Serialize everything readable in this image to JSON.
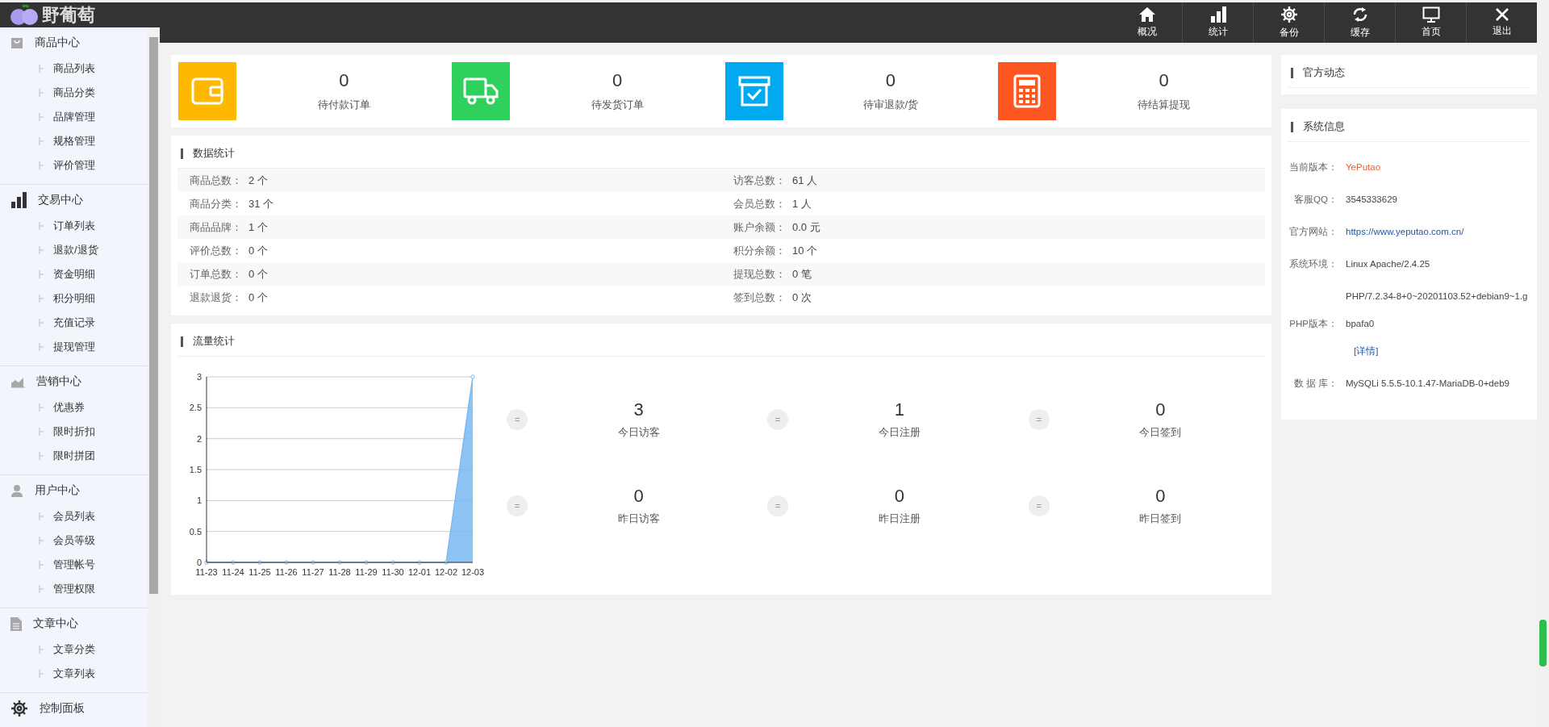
{
  "logo": {
    "text": "野葡萄"
  },
  "top_nav": [
    {
      "label": "概况"
    },
    {
      "label": "统计"
    },
    {
      "label": "备份"
    },
    {
      "label": "缓存"
    },
    {
      "label": "首页"
    },
    {
      "label": "退出"
    }
  ],
  "sidebar": {
    "groups": [
      {
        "title": "商品中心",
        "items": [
          "商品列表",
          "商品分类",
          "品牌管理",
          "规格管理",
          "评价管理"
        ]
      },
      {
        "title": "交易中心",
        "items": [
          "订单列表",
          "退款/退货",
          "资金明细",
          "积分明细",
          "充值记录",
          "提现管理"
        ]
      },
      {
        "title": "营销中心",
        "items": [
          "优惠券",
          "限时折扣",
          "限时拼团"
        ]
      },
      {
        "title": "用户中心",
        "items": [
          "会员列表",
          "会员等级",
          "管理帐号",
          "管理权限"
        ]
      },
      {
        "title": "文章中心",
        "items": [
          "文章分类",
          "文章列表"
        ]
      },
      {
        "title": "控制面板"
      }
    ]
  },
  "summary_cards": [
    {
      "color": "#ffb800",
      "value": "0",
      "label": "待付款订单"
    },
    {
      "color": "#2fd15d",
      "value": "0",
      "label": "待发货订单"
    },
    {
      "color": "#00a9f0",
      "value": "0",
      "label": "待审退款/货"
    },
    {
      "color": "#ff5722",
      "value": "0",
      "label": "待结算提现"
    }
  ],
  "data_stats": {
    "title": "数据统计",
    "rows": [
      [
        {
          "label": "商品总数：",
          "value": "2 个"
        },
        {
          "label": "访客总数：",
          "value": "61 人"
        }
      ],
      [
        {
          "label": "商品分类：",
          "value": "31 个"
        },
        {
          "label": "会员总数：",
          "value": "1 人"
        }
      ],
      [
        {
          "label": "商品品牌：",
          "value": "1 个"
        },
        {
          "label": "账户余额：",
          "value": "0.0 元"
        }
      ],
      [
        {
          "label": "评价总数：",
          "value": "0 个"
        },
        {
          "label": "积分余额：",
          "value": "10 个"
        }
      ],
      [
        {
          "label": "订单总数：",
          "value": "0 个"
        },
        {
          "label": "提现总数：",
          "value": "0 笔"
        }
      ],
      [
        {
          "label": "退款退货：",
          "value": "0 个"
        },
        {
          "label": "签到总数：",
          "value": "0 次"
        }
      ]
    ]
  },
  "traffic": {
    "title": "流量统计",
    "chart_data": {
      "type": "area",
      "categories": [
        "11-23",
        "11-24",
        "11-25",
        "11-26",
        "11-27",
        "11-28",
        "11-29",
        "11-30",
        "12-01",
        "12-02",
        "12-03"
      ],
      "grid": true,
      "series": [
        {
          "color": "#7ab8f5",
          "values": [
            0,
            0,
            0,
            0,
            0,
            0,
            0,
            0,
            0,
            0,
            3
          ]
        }
      ],
      "ylim": [
        0,
        3
      ],
      "yticks": [
        0,
        0.5,
        1,
        1.5,
        2,
        2.5,
        3
      ]
    },
    "counters": [
      {
        "badge": "=",
        "value": "3",
        "label": "今日访客"
      },
      {
        "badge": "=",
        "value": "1",
        "label": "今日注册"
      },
      {
        "badge": "=",
        "value": "0",
        "label": "今日签到"
      },
      {
        "badge": "=",
        "value": "0",
        "label": "昨日访客"
      },
      {
        "badge": "=",
        "value": "0",
        "label": "昨日注册"
      },
      {
        "badge": "=",
        "value": "0",
        "label": "昨日签到"
      }
    ]
  },
  "news": {
    "title": "官方动态"
  },
  "system_info": {
    "title": "系统信息",
    "rows": [
      {
        "label": "当前版本：",
        "value": "YePutao",
        "kind": "highlight"
      },
      {
        "label": "客服QQ：",
        "value": "3545333629",
        "kind": "text"
      },
      {
        "label": "官方网站：",
        "value": "https://www.yeputao.com.cn/",
        "kind": "link"
      },
      {
        "label": "系统环境：",
        "value": "Linux Apache/2.4.25",
        "kind": "text"
      },
      {
        "label": "PHP版本：",
        "value": "PHP/7.2.34-8+0~20201103.52+debian9~1.gbpafa0",
        "kind": "text",
        "link": "[详情]"
      },
      {
        "label": "数 据 库：",
        "value": "MySQLi 5.5.5-10.1.47-MariaDB-0+deb9",
        "kind": "text"
      }
    ]
  }
}
